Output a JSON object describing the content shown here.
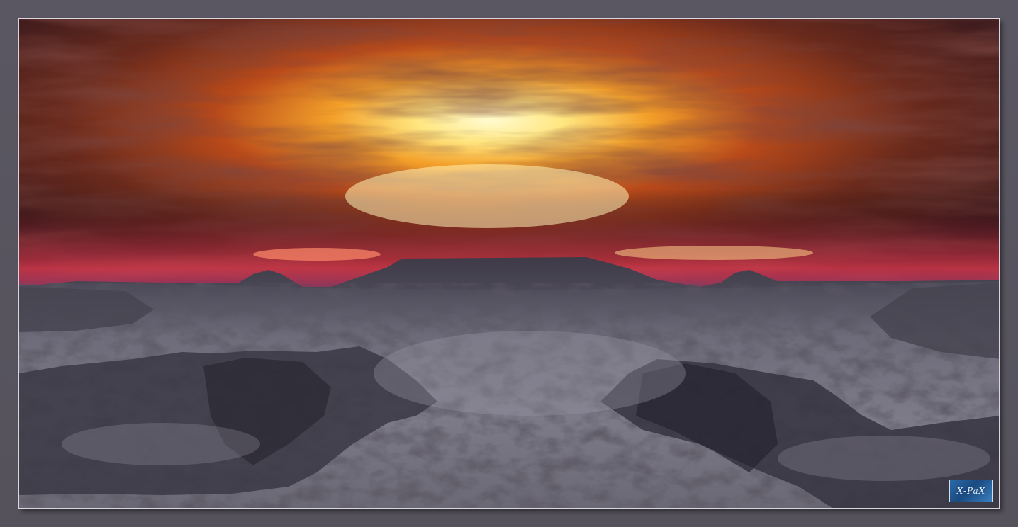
{
  "image": {
    "subject": "",
    "watermark_text": "X-PaX",
    "colors": {
      "frame": "#56535e",
      "border": "#d9d6df",
      "sun_core": "#fff7b0",
      "sky_orange": "#d9601c",
      "sky_dark": "#3a1a1e",
      "horizon_pink": "#e23a50",
      "terrain": "#4a4a58",
      "snow": "#8c8a96",
      "watermark_bg": "#2b6aa8"
    }
  }
}
